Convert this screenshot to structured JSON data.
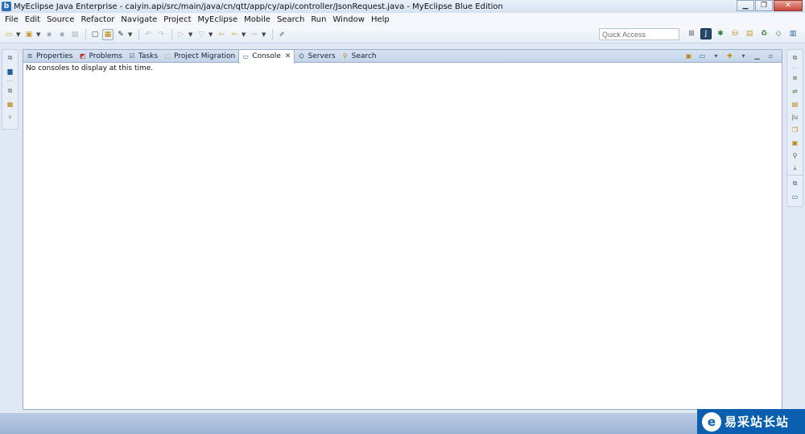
{
  "window": {
    "title": "MyEclipse Java Enterprise - caiyin.api/src/main/java/cn/qtt/app/cy/api/controller/JsonRequest.java - MyEclipse Blue Edition"
  },
  "menu": [
    "File",
    "Edit",
    "Source",
    "Refactor",
    "Navigate",
    "Project",
    "MyEclipse",
    "Mobile",
    "Search",
    "Run",
    "Window",
    "Help"
  ],
  "toolbar": {
    "quick_access_placeholder": "Quick Access"
  },
  "view": {
    "tabs": [
      {
        "label": "Properties",
        "icon": "properties-icon",
        "active": false
      },
      {
        "label": "Problems",
        "icon": "problems-icon",
        "active": false
      },
      {
        "label": "Tasks",
        "icon": "tasks-icon",
        "active": false
      },
      {
        "label": "Project Migration",
        "icon": "migration-icon",
        "active": false
      },
      {
        "label": "Console",
        "icon": "console-icon",
        "active": true
      },
      {
        "label": "Servers",
        "icon": "servers-icon",
        "active": false
      },
      {
        "label": "Search",
        "icon": "search-icon",
        "active": false
      }
    ],
    "console_message": "No consoles to display at this time."
  },
  "watermark": {
    "text": "易采站长站"
  },
  "colors": {
    "accent": "#26476e",
    "watermark_bg": "#0a5fb0"
  }
}
